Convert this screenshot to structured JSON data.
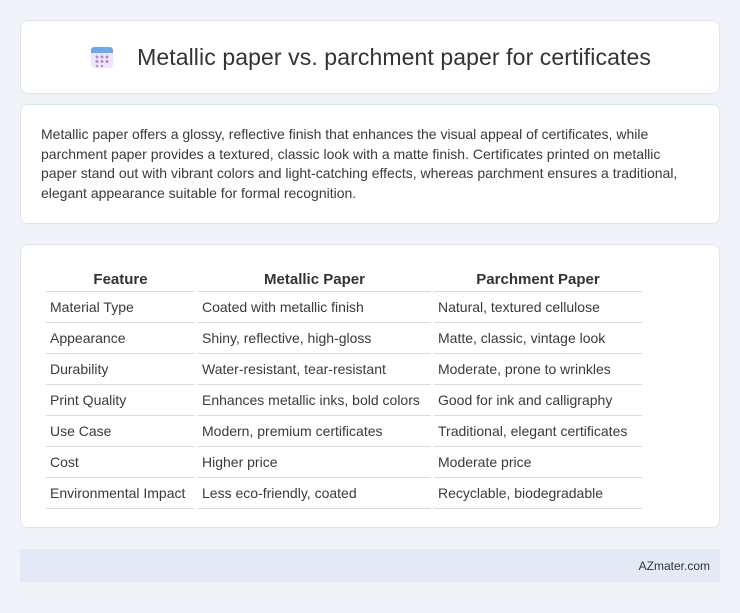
{
  "header": {
    "icon": "calendar-icon",
    "title": "Metallic paper vs. parchment paper for certificates"
  },
  "intro": {
    "text": "Metallic paper offers a glossy, reflective finish that enhances the visual appeal of certificates, while parchment paper provides a textured, classic look with a matte finish. Certificates printed on metallic paper stand out with vibrant colors and light-catching effects, whereas parchment ensures a traditional, elegant appearance suitable for formal recognition."
  },
  "table": {
    "headers": [
      "Feature",
      "Metallic Paper",
      "Parchment Paper"
    ],
    "rows": [
      [
        "Material Type",
        "Coated with metallic finish",
        "Natural, textured cellulose"
      ],
      [
        "Appearance",
        "Shiny, reflective, high-gloss",
        "Matte, classic, vintage look"
      ],
      [
        "Durability",
        "Water-resistant, tear-resistant",
        "Moderate, prone to wrinkles"
      ],
      [
        "Print Quality",
        "Enhances metallic inks, bold colors",
        "Good for ink and calligraphy"
      ],
      [
        "Use Case",
        "Modern, premium certificates",
        "Traditional, elegant certificates"
      ],
      [
        "Cost",
        "Higher price",
        "Moderate price"
      ],
      [
        "Environmental Impact",
        "Less eco-friendly, coated",
        "Recyclable, biodegradable"
      ]
    ]
  },
  "footer": {
    "credit": "AZmater.com"
  },
  "colors": {
    "background": "#f0f3f8",
    "card": "#ffffff",
    "footer": "#e4eaf5",
    "icon_top": "#6aa8f0",
    "icon_body": "#efe6fb",
    "icon_dots": "#b08ad9"
  }
}
